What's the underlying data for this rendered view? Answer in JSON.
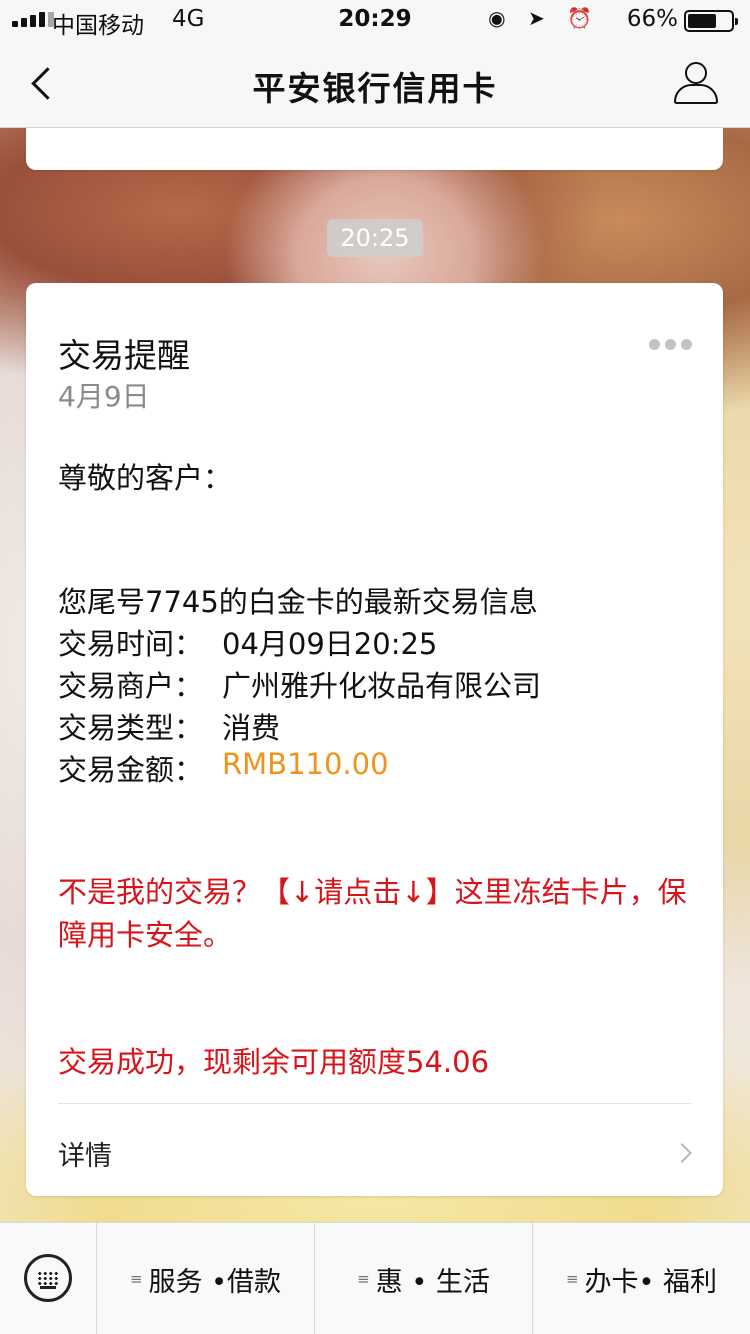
{
  "status_bar": {
    "carrier": "中国移动",
    "network": "4G",
    "time": "20:29",
    "icons": "◉ ➤ ⏰",
    "battery": "66%",
    "battery_level": 0.66
  },
  "nav": {
    "title": "平安银行信用卡",
    "back_icon": "chevron-left-icon",
    "profile_icon": "person-icon"
  },
  "timestamp": "20:25",
  "card": {
    "title": "交易提醒",
    "date": "4月9日",
    "greeting": "尊敬的客户：",
    "summary": "您尾号7745的白金卡的最新交易信息",
    "fields": [
      {
        "label": "交易时间：",
        "value": "04月09日20:25"
      },
      {
        "label": "交易商户：",
        "value": "广州雅升化妆品有限公司"
      },
      {
        "label": "交易类型：",
        "value": "消费"
      },
      {
        "label": "交易金额：",
        "value": "RMB110.00"
      }
    ],
    "warning": "不是我的交易？【↓请点击↓】这里冻结卡片，保障用卡安全。",
    "success": "交易成功，现剩余可用额度54.06",
    "detail_label": "详情"
  },
  "bottom_menu": {
    "keyboard_icon": "keyboard-icon",
    "menu_icon": "≡",
    "items": [
      {
        "label": "服务 •借款"
      },
      {
        "label": "惠 • 生活"
      },
      {
        "label": "办卡• 福利"
      }
    ]
  },
  "colors": {
    "amount": "#f0931d",
    "alert_red": "#d8141b"
  }
}
